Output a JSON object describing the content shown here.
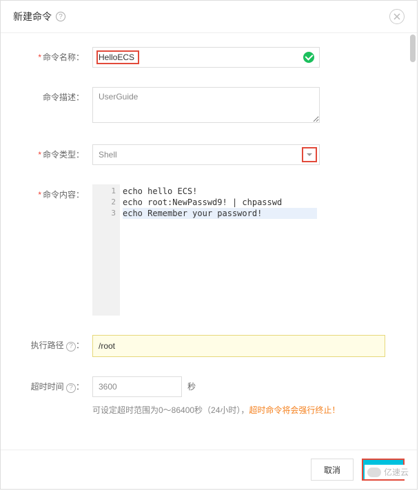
{
  "header": {
    "title": "新建命令"
  },
  "form": {
    "name_label": "命令名称：",
    "name_value": "HelloECS",
    "desc_label": "命令描述：",
    "desc_value": "UserGuide",
    "type_label": "命令类型：",
    "type_value": "Shell",
    "content_label": "命令内容：",
    "code_line1": "echo hello ECS!",
    "code_line2": "echo root:NewPasswd9! | chpasswd",
    "code_line3": "echo Remember your password!",
    "path_label": "执行路径 ",
    "path_value": "/root",
    "timeout_label": "超时时间 ",
    "timeout_value": "3600",
    "timeout_unit": "秒",
    "timeout_hint_pre": "可设定超时范围为0～86400秒（24小时），",
    "timeout_hint_warn": "超时命令将会强行终止！"
  },
  "gutter": {
    "l1": "1",
    "l2": "2",
    "l3": "3"
  },
  "footer": {
    "cancel": "取消",
    "confirm": " "
  },
  "watermark": "亿速云"
}
